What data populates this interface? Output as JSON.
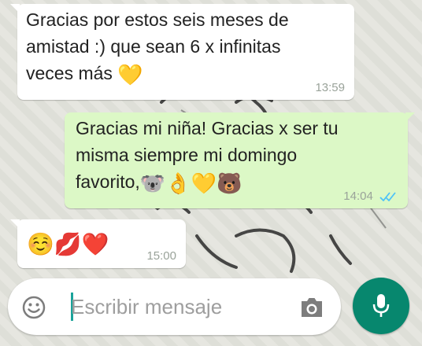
{
  "messages": [
    {
      "direction": "in",
      "text": "Gracias por estos seis meses de\namistad :) que sean 6 x infinitas\nveces más",
      "emojis": "💛",
      "time": "13:59"
    },
    {
      "direction": "out",
      "text": "Gracias mi niña! Gracias x ser tu\nmisma siempre mi domingo\nfavorito,",
      "emojis": "🐨👌💛🐻",
      "time": "14:04",
      "status": "read-double-ticks"
    },
    {
      "direction": "in",
      "text": "",
      "emojis": "☺️💋❤️",
      "time": "15:00"
    }
  ],
  "composer": {
    "placeholder": "Escribir mensaje",
    "emoji_icon": "smiley-icon",
    "camera_icon": "camera-icon",
    "mic_icon": "microphone-icon"
  },
  "colors": {
    "incoming_bubble": "#ffffff",
    "outgoing_bubble": "#dcf8c6",
    "accent": "#07876e",
    "read_ticks": "#4fc3f7"
  }
}
